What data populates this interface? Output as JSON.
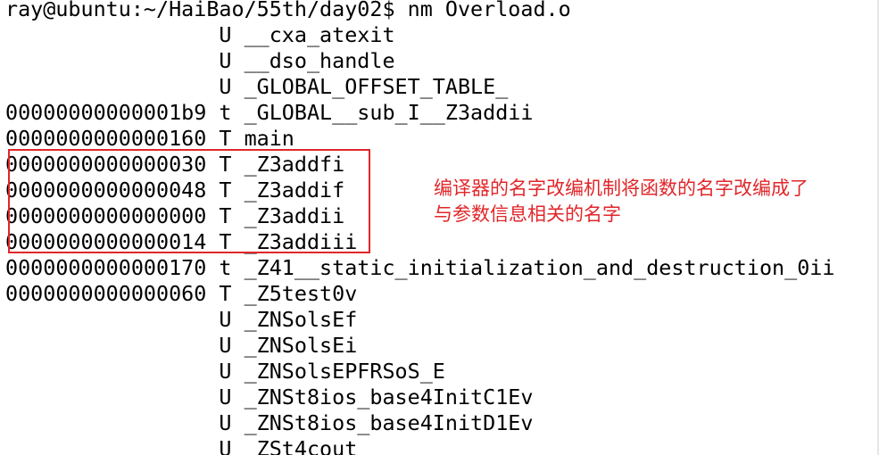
{
  "terminal": {
    "lines": [
      "ray@ubuntu:~/HaiBao/55th/day02$ nm Overload.o",
      "                 U __cxa_atexit",
      "                 U __dso_handle",
      "                 U _GLOBAL_OFFSET_TABLE_",
      "00000000000001b9 t _GLOBAL__sub_I__Z3addii",
      "0000000000000160 T main",
      "0000000000000030 T _Z3addfi",
      "0000000000000048 T _Z3addif",
      "0000000000000000 T _Z3addii",
      "0000000000000014 T _Z3addiii",
      "0000000000000170 t _Z41__static_initialization_and_destruction_0ii",
      "0000000000000060 T _Z5test0v",
      "                 U _ZNSolsEf",
      "                 U _ZNSolsEi",
      "                 U _ZNSolsEPFRSoS_E",
      "                 U _ZNSt8ios_base4InitC1Ev",
      "                 U _ZNSt8ios_base4InitD1Ev",
      "                 U _ZSt4cout"
    ]
  },
  "annotation": {
    "line1": "编译器的名字改编机制将函数的名字改编成了",
    "line2": "与参数信息相关的名字",
    "color": "#e0262a"
  },
  "colors": {
    "background": "#ffffff",
    "text": "#000000",
    "highlight": "#e0262a"
  }
}
